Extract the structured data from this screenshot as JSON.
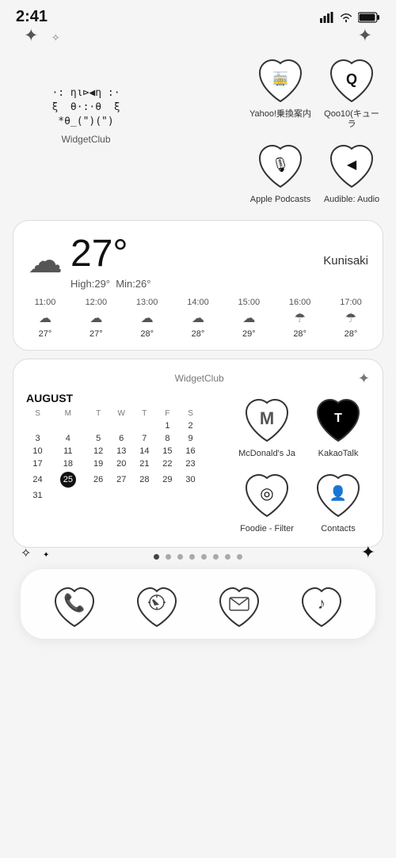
{
  "statusBar": {
    "time": "2:41",
    "signal": "▐▐▐▐",
    "wifi": "wifi",
    "battery": "battery"
  },
  "sparkles": {
    "tl": "✦",
    "tl2": "✧",
    "tr": "✦"
  },
  "widgetClub": {
    "label": "WidgetClub",
    "art": [
      "·: ηΐ⊳◀η :·",
      "ξ  θ·:·θ  ξ",
      "*θ_(\")(\")"
    ]
  },
  "apps": {
    "row1": [
      {
        "label": "Yahoo!乗換案内",
        "symbol": "🚋"
      },
      {
        "label": "Qoo10(キューラ",
        "symbol": "Q"
      }
    ],
    "row2": [
      {
        "label": "Apple Podcasts",
        "symbol": "🎙"
      },
      {
        "label": "Audible: Audio",
        "symbol": "▶"
      }
    ]
  },
  "weather": {
    "location": "Kunisaki",
    "temp": "27°",
    "high": "High:29°",
    "min": "Min:26°",
    "hours": [
      {
        "time": "11:00",
        "icon": "☁",
        "temp": "27°"
      },
      {
        "time": "12:00",
        "icon": "☁",
        "temp": "27°"
      },
      {
        "time": "13:00",
        "icon": "☁",
        "temp": "28°"
      },
      {
        "time": "14:00",
        "icon": "☁",
        "temp": "28°"
      },
      {
        "time": "15:00",
        "icon": "☁",
        "temp": "29°"
      },
      {
        "time": "16:00",
        "icon": "☂",
        "temp": "28°"
      },
      {
        "time": "17:00",
        "icon": "☂",
        "temp": "28°"
      }
    ]
  },
  "calendarWidget": {
    "widgetTitle": "WidgetClub",
    "month": "AUGUST",
    "weekdays": [
      "S",
      "M",
      "T",
      "W",
      "T",
      "F",
      "S"
    ],
    "weeks": [
      [
        "",
        "",
        "",
        "",
        "",
        "1",
        "2",
        "3"
      ],
      [
        "4",
        "5",
        "6",
        "7",
        "8",
        "9",
        "10"
      ],
      [
        "11",
        "12",
        "13",
        "14",
        "15",
        "16",
        "17"
      ],
      [
        "18",
        "19",
        "20",
        "21",
        "22",
        "23",
        "24"
      ],
      [
        "25",
        "26",
        "27",
        "28",
        "29",
        "30",
        "31"
      ]
    ],
    "today": "25",
    "calApps": [
      {
        "label": "McDonald's Ja",
        "symbol": "M"
      },
      {
        "label": "KakaoTalk",
        "symbol": "T"
      },
      {
        "label": "Foodie - Filter",
        "symbol": "◎"
      },
      {
        "label": "Contacts",
        "symbol": "👤"
      }
    ]
  },
  "pageDots": {
    "count": 8,
    "active": 0
  },
  "dock": [
    {
      "name": "phone-icon",
      "label": "Phone",
      "symbol": "📞"
    },
    {
      "name": "compass-icon",
      "label": "Safari",
      "symbol": "🧭"
    },
    {
      "name": "mail-icon",
      "label": "Mail",
      "symbol": "✉"
    },
    {
      "name": "music-icon",
      "label": "Music",
      "symbol": "♪"
    }
  ]
}
